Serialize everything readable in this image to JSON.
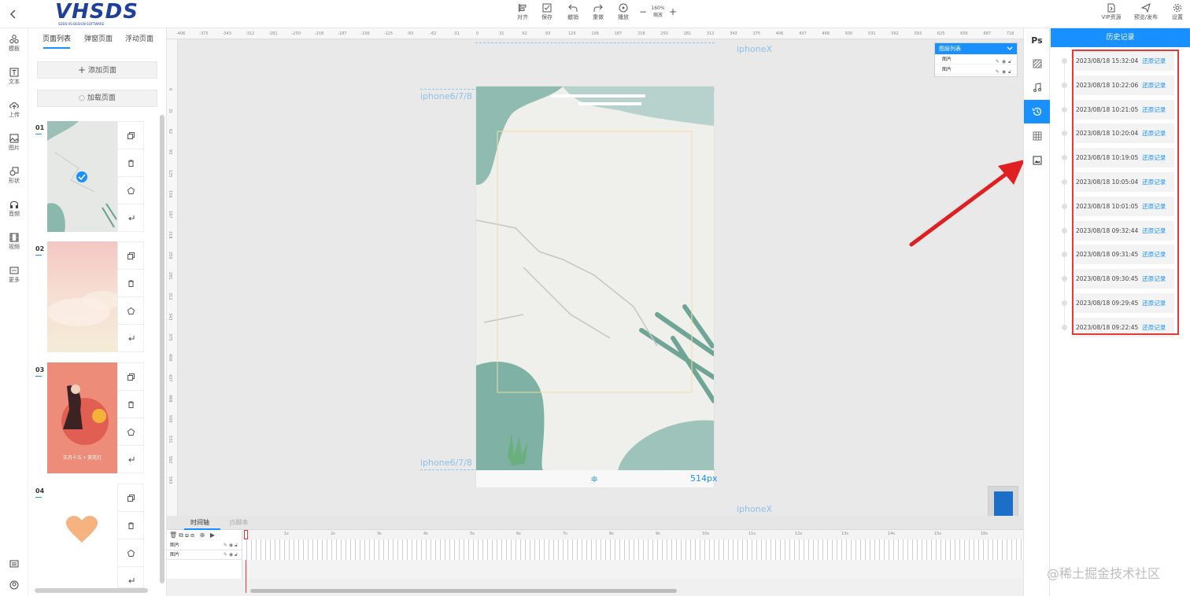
{
  "top_bar": {
    "logo_text": "VHSDS",
    "logo_sub": "SDDS-VS-DESIGN-SOFTWARE",
    "align_label": "对齐",
    "save_label": "保存",
    "undo_label": "撤销",
    "redo_label": "重做",
    "play_label": "播放",
    "zoom_label": "缩放",
    "zoom_value": "160%",
    "vip_label": "VIP资源",
    "preview_label": "预览/发布",
    "settings_label": "设置"
  },
  "left_rail": {
    "items": [
      {
        "label": "模板",
        "icon": "template-icon"
      },
      {
        "label": "文本",
        "icon": "text-icon"
      },
      {
        "label": "上传",
        "icon": "upload-icon"
      },
      {
        "label": "图片",
        "icon": "image-icon"
      },
      {
        "label": "形状",
        "icon": "shape-icon"
      },
      {
        "label": "音频",
        "icon": "audio-icon"
      },
      {
        "label": "视频",
        "icon": "video-icon"
      },
      {
        "label": "更多",
        "icon": "more-icon"
      }
    ]
  },
  "page_panel": {
    "tabs": [
      "页面列表",
      "弹窗页面",
      "浮动页面"
    ],
    "active_tab": "页面列表",
    "add_page_label": "添加页面",
    "load_page_label": "加载页面",
    "pages": [
      {
        "num": "01"
      },
      {
        "num": "02"
      },
      {
        "num": "03",
        "poster_text": "正月十五 • 赏花灯"
      },
      {
        "num": "04"
      }
    ]
  },
  "canvas": {
    "ruler_ticks": [
      "-406",
      "-375",
      "-343",
      "-312",
      "-281",
      "-250",
      "-218",
      "-187",
      "-156",
      "-125",
      "-93",
      "-62",
      "-31",
      "0",
      "31",
      "62",
      "93",
      "125",
      "156",
      "187",
      "218",
      "250",
      "281",
      "312",
      "343",
      "375",
      "406",
      "437",
      "468",
      "500",
      "531",
      "562",
      "593",
      "625",
      "656",
      "687",
      "718"
    ],
    "vruler_ticks": [
      "0",
      "31",
      "62",
      "93",
      "125",
      "156",
      "187",
      "218",
      "250",
      "281",
      "312",
      "343",
      "375",
      "406",
      "437",
      "468",
      "500",
      "531",
      "562",
      "593"
    ],
    "guide_iphonex": "iphoneX",
    "guide_iphone678": "iphone6/7/8",
    "height_label": "514px",
    "layer_list": {
      "title": "图层列表",
      "rows": [
        "图片",
        "图片"
      ]
    }
  },
  "timeline": {
    "tabs": [
      "时间轴",
      "JS脚本"
    ],
    "rows": [
      "图片",
      "图片"
    ],
    "seconds": [
      "1s",
      "2s",
      "3s",
      "4s",
      "5s",
      "6s",
      "7s",
      "8s",
      "9s",
      "10s",
      "11s",
      "12s",
      "13s",
      "14s",
      "15s",
      "16s"
    ]
  },
  "right_bar": {
    "items": [
      "ps-icon",
      "texture-icon",
      "music-icon",
      "history-icon",
      "grid-icon",
      "image-frame-icon"
    ],
    "active": "history-icon"
  },
  "history": {
    "title": "历史记录",
    "restore_label": "还原记录",
    "records": [
      "2023/08/18 15:32:04",
      "2023/08/18 10:22:06",
      "2023/08/18 10:21:05",
      "2023/08/18 10:20:04",
      "2023/08/18 10:19:05",
      "2023/08/18 10:05:04",
      "2023/08/18 10:01:05",
      "2023/08/18 09:32:44",
      "2023/08/18 09:31:45",
      "2023/08/18 09:30:45",
      "2023/08/18 09:29:45",
      "2023/08/18 09:22:45"
    ]
  },
  "watermark": "@稀土掘金技术社区",
  "colors": {
    "accent": "#1890ff",
    "highlight_border": "#e53935",
    "arrow": "#e02020"
  }
}
